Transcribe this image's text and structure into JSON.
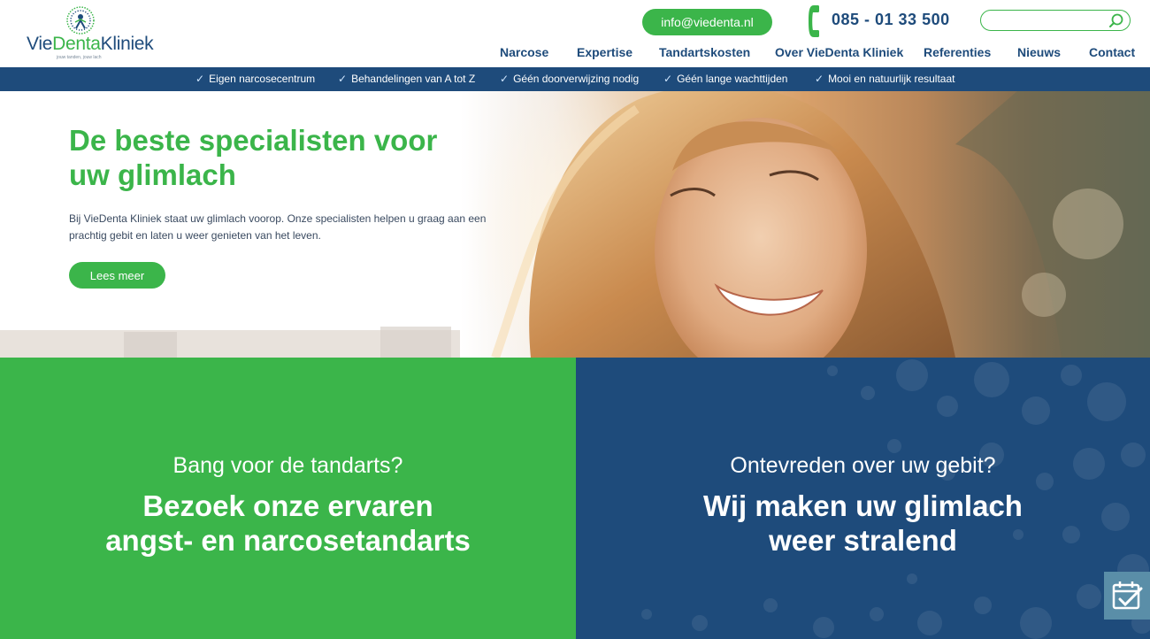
{
  "brand": {
    "name_part1": "Vie",
    "name_part2": "Denta",
    "name_part3": "Kliniek",
    "tagline": "jouw tanden, jouw lach"
  },
  "header": {
    "email": "info@viedenta.nl",
    "phone": "085 - 01 33 500",
    "search_placeholder": ""
  },
  "nav": {
    "items": [
      {
        "label": "Narcose"
      },
      {
        "label": "Expertise"
      },
      {
        "label": "Tandartskosten"
      },
      {
        "label": "Over VieDenta Kliniek"
      },
      {
        "label": "Referenties"
      },
      {
        "label": "Nieuws"
      },
      {
        "label": "Contact"
      }
    ]
  },
  "benefits": [
    {
      "label": "Eigen narcosecentrum"
    },
    {
      "label": "Behandelingen van A tot Z"
    },
    {
      "label": "Géén doorverwijzing nodig"
    },
    {
      "label": "Géén lange wachttijden"
    },
    {
      "label": "Mooi en natuurlijk resultaat"
    }
  ],
  "hero": {
    "title_line1": "De beste specialisten voor",
    "title_line2": "uw glimlach",
    "text_line1": "Bij VieDenta Kliniek staat uw glimlach voorop. Onze specialisten helpen u graag aan een",
    "text_line2": "prachtig gebit en laten u weer genieten van het leven.",
    "button": "Lees meer"
  },
  "panels": {
    "left": {
      "subtitle": "Bang voor de tandarts?",
      "title_line1": "Bezoek onze ervaren",
      "title_line2": "angst- en narcosetandarts"
    },
    "right": {
      "subtitle": "Ontevreden over uw gebit?",
      "title_line1": "Wij maken uw glimlach",
      "title_line2": "weer stralend"
    }
  },
  "icons": {
    "phone": "phone-icon",
    "search": "search-icon",
    "check": "check-icon",
    "calendar": "calendar-check-icon"
  },
  "colors": {
    "green": "#3bb54a",
    "navy": "#1e4b7b"
  }
}
